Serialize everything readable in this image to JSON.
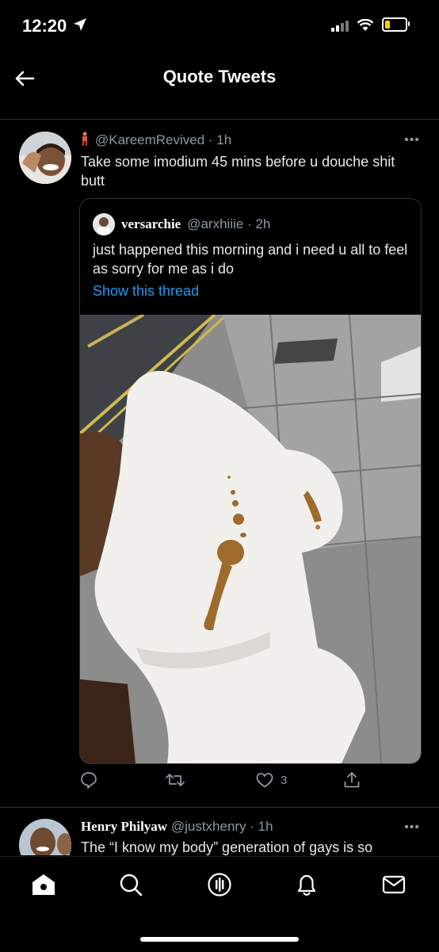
{
  "status_bar": {
    "time": "12:20"
  },
  "header": {
    "title": "Quote Tweets"
  },
  "tweet1": {
    "handle_time": "@KareemRevived · 1h",
    "text": "Take some imodium 45 mins before u douche shit butt",
    "more": "•••",
    "quoted": {
      "name": "versarchie",
      "handle_time": "@arxhiiie · 2h",
      "text": "just happened this morning and i need u all to feel as sorry for me as i do",
      "link": "Show this thread"
    },
    "actions": {
      "like_count": "3"
    }
  },
  "tweet2": {
    "name": "Henry Philyaw",
    "handle_time": "@justxhenry · 1h",
    "text": "The “I know my body” generation of gays is so",
    "more": "•••"
  },
  "colors": {
    "background": "#000000",
    "link": "#1d9bf0",
    "muted": "#8b98a5",
    "text": "#e7e9ea"
  },
  "tab_bar": {
    "items": [
      "home-icon",
      "search-icon",
      "spaces-icon",
      "notifications-icon",
      "messages-icon"
    ]
  }
}
